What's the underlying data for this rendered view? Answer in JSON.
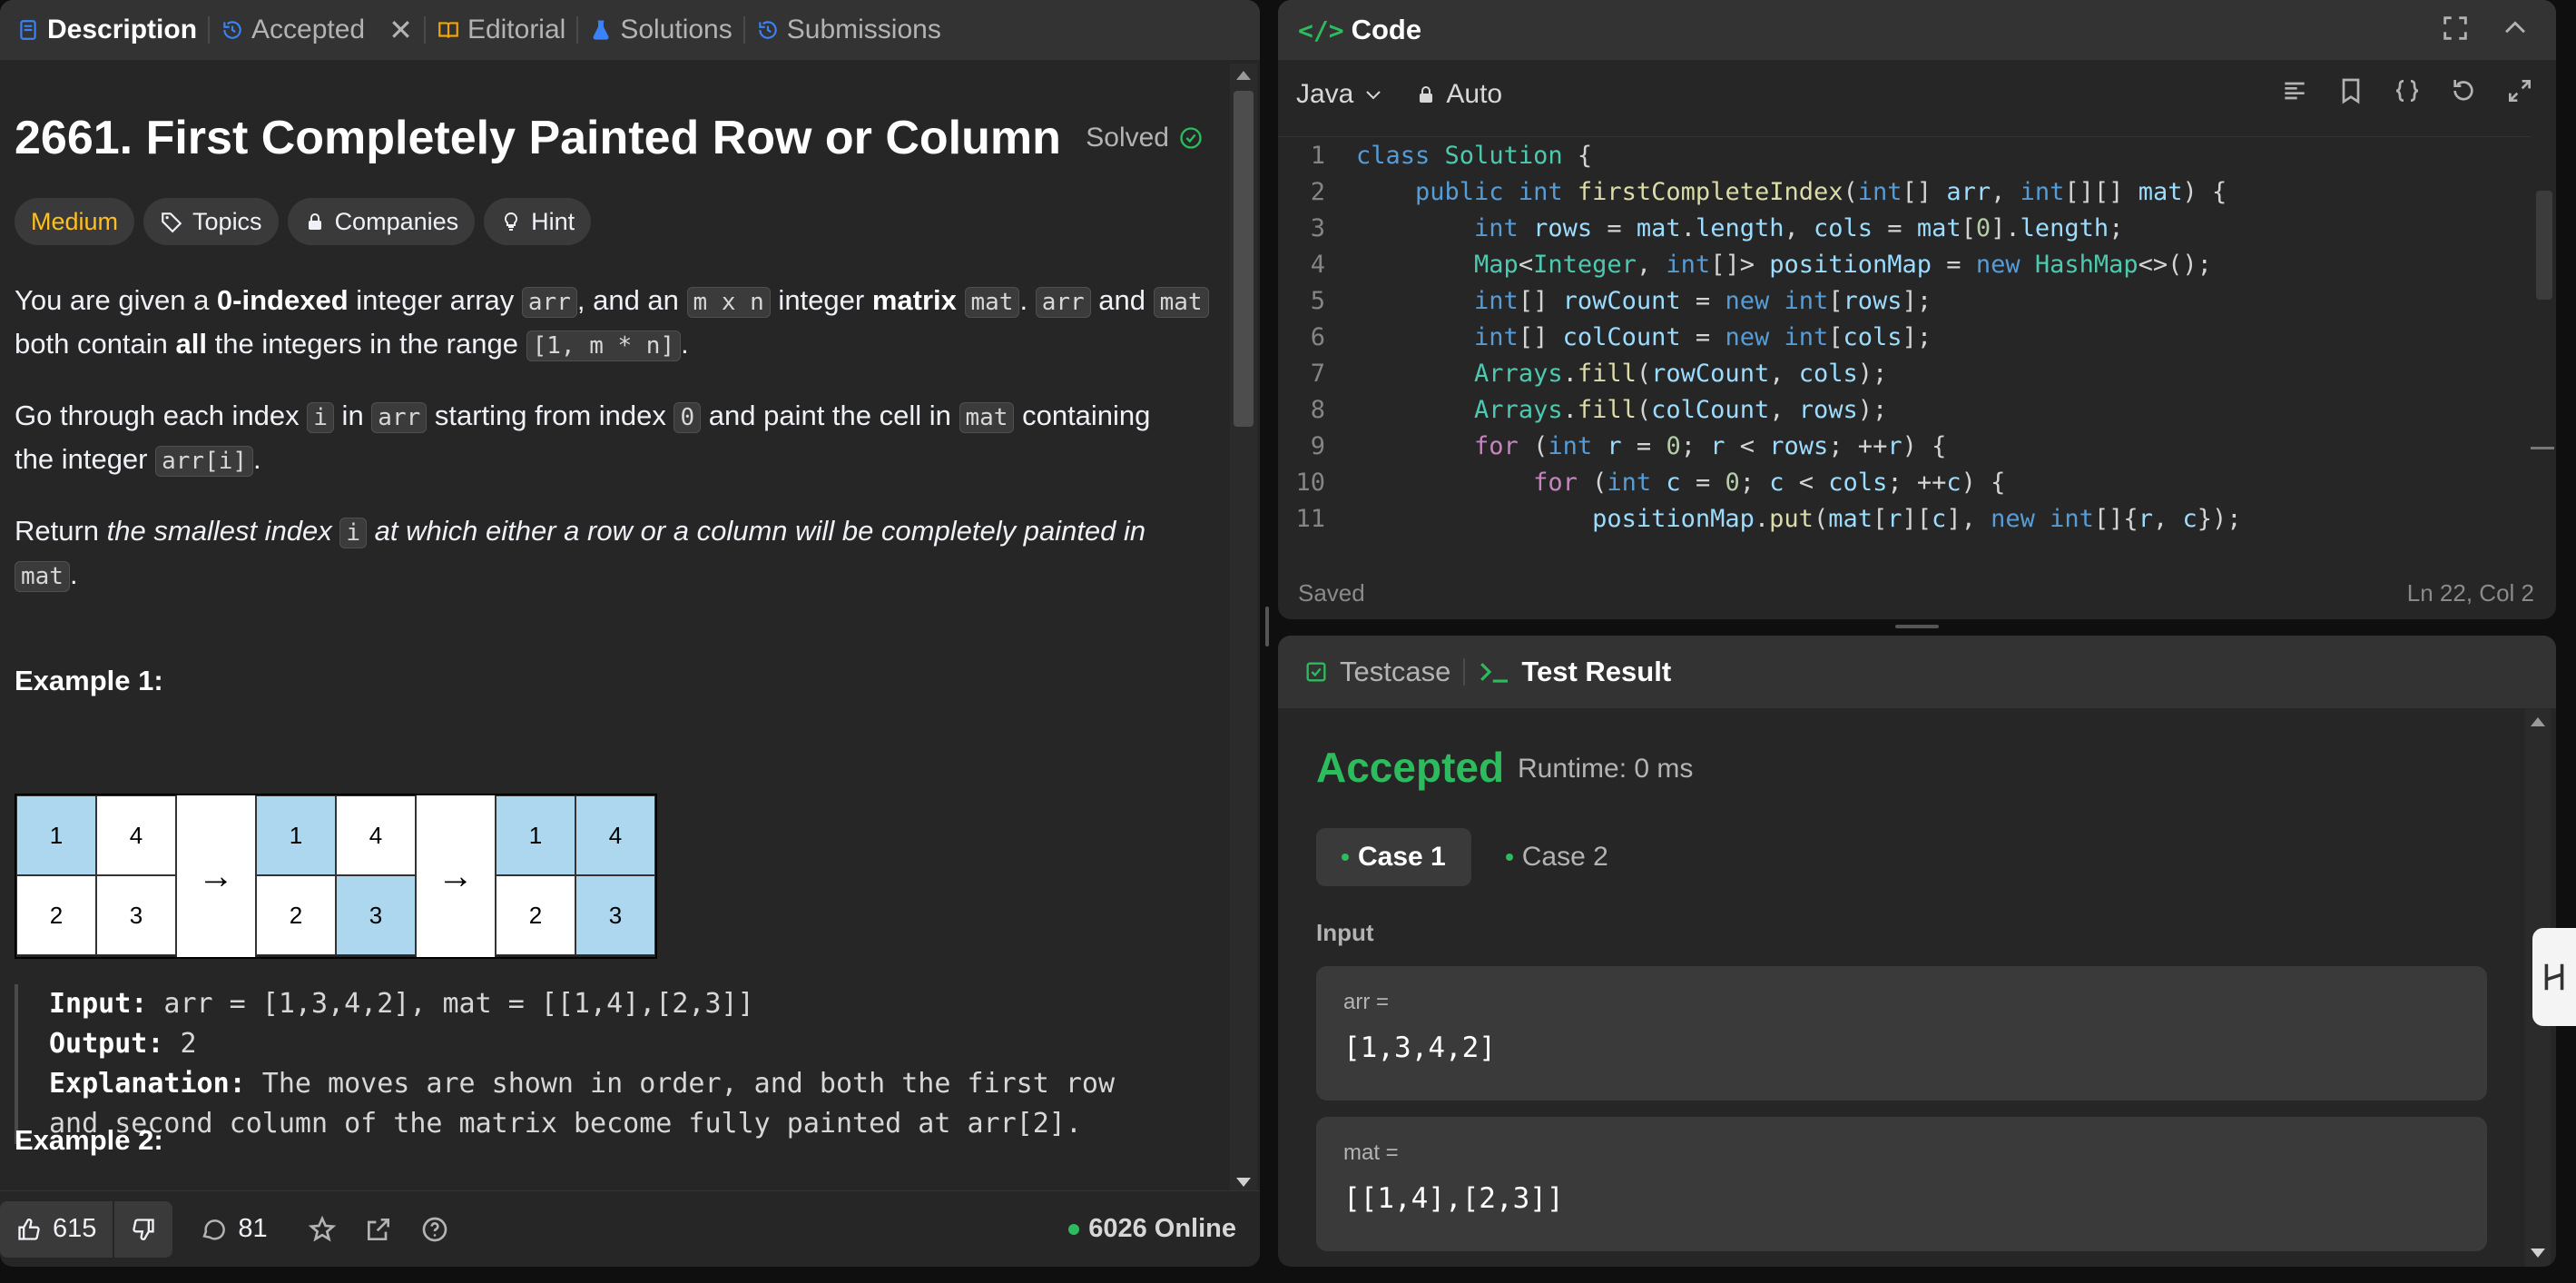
{
  "tabs": {
    "description": "Description",
    "accepted": "Accepted",
    "editorial": "Editorial",
    "solutions": "Solutions",
    "submissions": "Submissions"
  },
  "problem": {
    "title": "2661. First Completely Painted Row or Column",
    "status": "Solved",
    "difficulty": "Medium",
    "chips": [
      "Topics",
      "Companies",
      "Hint"
    ]
  },
  "description": {
    "p1": [
      "You are given a ",
      "0-indexed",
      " integer array ",
      "arr",
      ", and an ",
      "m x n",
      " integer ",
      "matrix",
      " ",
      "mat",
      ". ",
      "arr",
      " and ",
      "mat"
    ],
    "p1b": [
      "both contain ",
      "all",
      " the integers in the range ",
      "[1, m * n]",
      "."
    ],
    "p2": [
      "Go through each index ",
      "i",
      " in ",
      "arr",
      " starting from index ",
      "0",
      " and paint the cell in ",
      "mat",
      " containing"
    ],
    "p2b": [
      "the integer ",
      "arr[i]",
      "."
    ],
    "p3": [
      "Return ",
      "the smallest index ",
      "i",
      " at which either a row or a column will be completely painted in ",
      "mat",
      "."
    ]
  },
  "example1": {
    "heading": "Example 1:",
    "grid": {
      "arrow": "→",
      "step1": [
        [
          "1",
          "4"
        ],
        [
          "2",
          "3"
        ]
      ],
      "step2": [
        [
          "1",
          "4"
        ],
        [
          "2",
          "3"
        ]
      ],
      "step3": [
        [
          "1",
          "4"
        ],
        [
          "2",
          "3"
        ]
      ]
    },
    "input_label": "Input:",
    "input": " arr = [1,3,4,2], mat = [[1,4],[2,3]]",
    "output_label": "Output:",
    "output": " 2",
    "explanation_label": "Explanation:",
    "explanation1": " The moves are shown in order, and both the first row",
    "explanation2": "and second column of the matrix become fully painted at arr[2]."
  },
  "example2": {
    "heading": "Example 2:"
  },
  "footer": {
    "likes": "615",
    "comments": "81",
    "online": "6026 Online"
  },
  "code": {
    "header": "Code",
    "language": "Java",
    "mode": "Auto",
    "status": "Saved",
    "position": "Ln 22, Col 2",
    "line_numbers": [
      "1",
      "2",
      "3",
      "4",
      "5",
      "6",
      "7",
      "8",
      "9",
      "10",
      "11"
    ]
  },
  "test": {
    "testcase_tab": "Testcase",
    "result_tab": "Test Result",
    "verdict": "Accepted",
    "runtime": "Runtime: 0 ms",
    "cases": [
      "Case 1",
      "Case 2"
    ],
    "input_label": "Input",
    "arr_label": "arr =",
    "arr_value": "[1,3,4,2]",
    "mat_label": "mat =",
    "mat_value": "[[1,4],[2,3]]"
  },
  "colors": {
    "accepted": "#2cbb5d",
    "medium": "#ffc01e",
    "painted": "#acd7ef",
    "panel": "#262626"
  }
}
